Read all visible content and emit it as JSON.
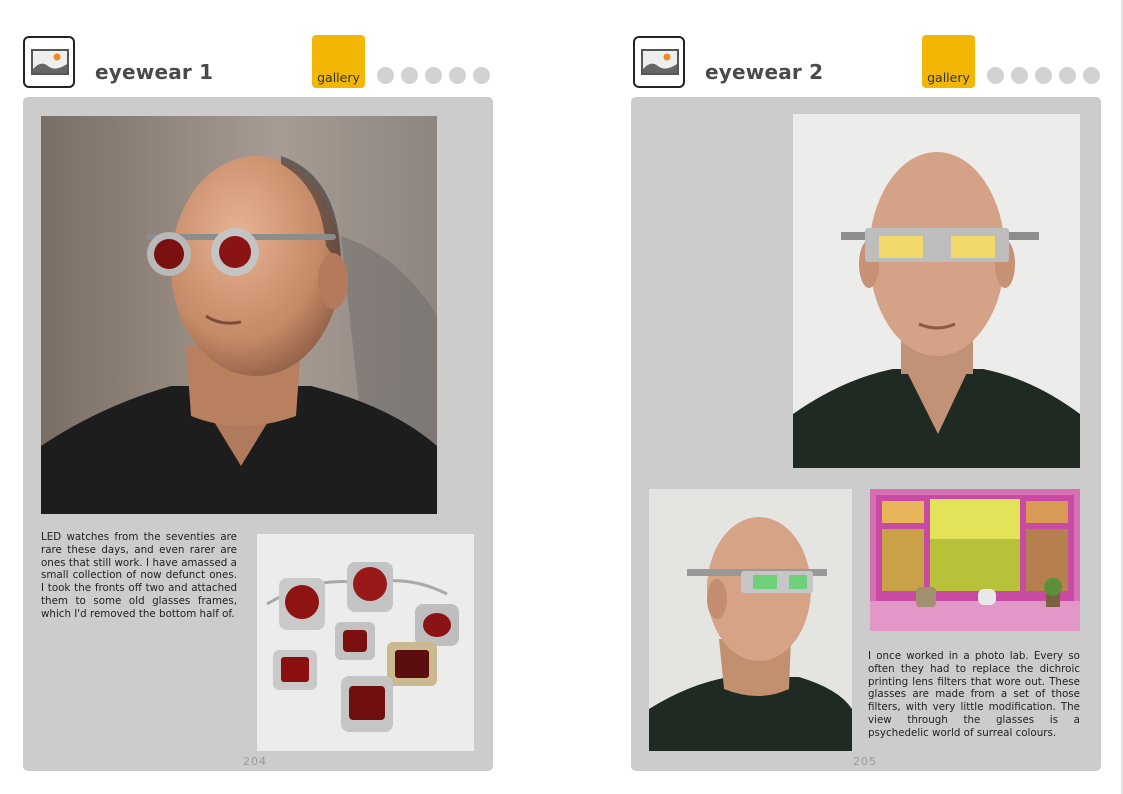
{
  "pages": [
    {
      "title": "eyewear 1",
      "gallery_label": "gallery",
      "page_number": "204",
      "body_text": "LED watches from the seventies are rare these days, and even rarer are ones that still work. I have amassed a small collection of now defunct ones. I took the fronts off two and attached them to some old glasses frames, which I'd removed the bottom half of.",
      "icons": [
        "image-icon"
      ],
      "nav_dots": 5
    },
    {
      "title": "eyewear 2",
      "gallery_label": "gallery",
      "page_number": "205",
      "body_text": "I once worked in a photo lab. Every so often they had to replace the dichroic printing lens filters that wore out. These glasses are made from a set of those filters, with very little modification. The view through the glasses is a psychedelic world of surreal colours.",
      "icons": [
        "image-icon"
      ],
      "nav_dots": 5
    }
  ],
  "colors": {
    "gallery_tab": "#f2b705",
    "panel": "#cccccc",
    "nav_dot": "#d2d2d2",
    "title": "#4a4a4a"
  }
}
